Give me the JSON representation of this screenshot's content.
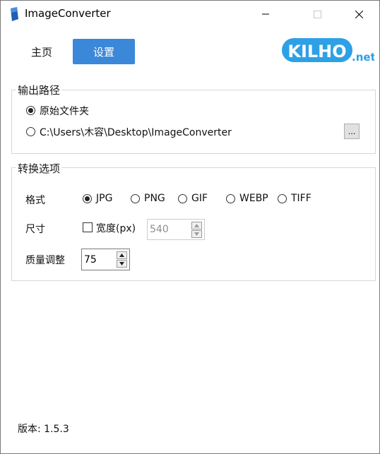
{
  "window": {
    "title": "ImageConverter"
  },
  "tabs": {
    "home": "主页",
    "settings": "设置"
  },
  "logo": {
    "main": "KILHO",
    "suffix": ".net",
    "color": "#2ea0e6"
  },
  "output_path": {
    "group_label": "输出路径",
    "option_original": "原始文件夹",
    "option_custom_path": "C:\\Users\\木容\\Desktop\\ImageConverter",
    "browse_label": "...",
    "selected": "original"
  },
  "conversion": {
    "group_label": "转换选项",
    "format_label": "格式",
    "formats": [
      "JPG",
      "PNG",
      "GIF",
      "WEBP",
      "TIFF"
    ],
    "selected_format": "JPG",
    "size_label": "尺寸",
    "width_checkbox_label": "宽度(px)",
    "width_checked": false,
    "width_value": "540",
    "quality_label": "质量调整",
    "quality_value": "75"
  },
  "footer": {
    "version": "版本: 1.5.3"
  },
  "colors": {
    "accent": "#3b88d8",
    "app_icon": "#1e5fb4"
  },
  "icons": {
    "app": "app-icon",
    "minimize": "minimize-icon",
    "maximize": "maximize-icon",
    "close": "close-icon"
  }
}
